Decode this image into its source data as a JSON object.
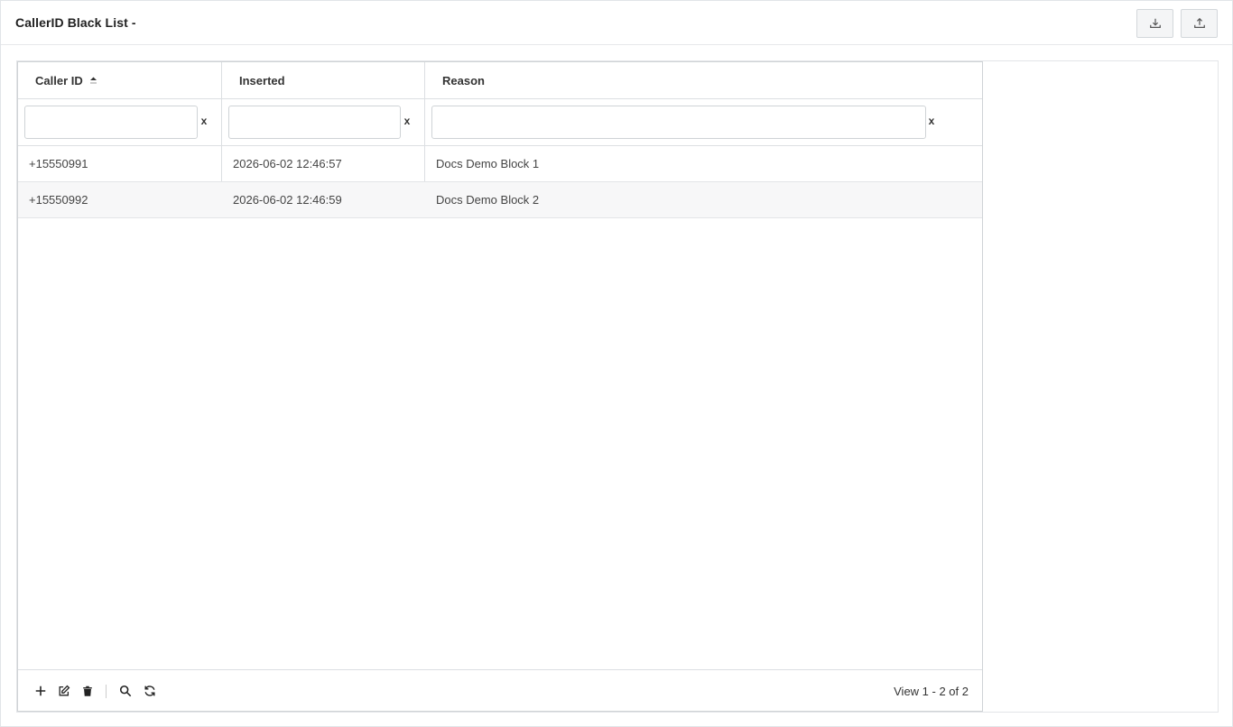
{
  "page": {
    "title": "CallerID Black List -"
  },
  "header_actions": [
    {
      "name": "download-icon"
    },
    {
      "name": "upload-icon"
    }
  ],
  "grid": {
    "columns": [
      {
        "label": "Caller ID",
        "sorted": "asc"
      },
      {
        "label": "Inserted"
      },
      {
        "label": "Reason"
      }
    ],
    "filters": [
      {
        "value": "",
        "clear_label": "x"
      },
      {
        "value": "",
        "clear_label": "x"
      },
      {
        "value": "",
        "clear_label": "x"
      }
    ],
    "rows": [
      {
        "caller_id": "+15550991",
        "inserted": "2026-06-02 12:46:57",
        "reason": "Docs Demo Block 1"
      },
      {
        "caller_id": "+15550992",
        "inserted": "2026-06-02 12:46:59",
        "reason": "Docs Demo Block 2"
      }
    ],
    "footer": {
      "actions": [
        "add-icon",
        "edit-icon",
        "delete-icon",
        "search-icon",
        "refresh-icon"
      ],
      "pager_text": "View 1 - 2 of 2"
    }
  }
}
